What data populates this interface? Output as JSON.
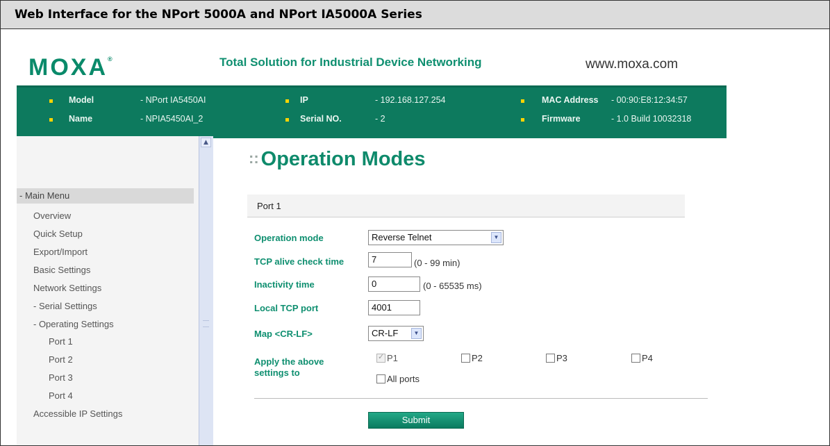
{
  "caption": "Web Interface for the NPort 5000A and NPort IA5000A Series",
  "header": {
    "logo": "MOXA",
    "logo_mark": "®",
    "tagline": "Total Solution for Industrial Device Networking",
    "website": "www.moxa.com"
  },
  "info": {
    "model_label": "Model",
    "model_value": "- NPort IA5450AI",
    "name_label": "Name",
    "name_value": "- NPIA5450AI_2",
    "ip_label": "IP",
    "ip_value": "- 192.168.127.254",
    "serial_label": "Serial NO.",
    "serial_value": "- 2",
    "mac_label": "MAC Address",
    "mac_value": "- 00:90:E8:12:34:57",
    "firmware_label": "Firmware",
    "firmware_value": "- 1.0 Build 10032318"
  },
  "sidebar": {
    "head": "- Main Menu",
    "items": [
      "Overview",
      "Quick Setup",
      "Export/Import",
      "Basic Settings",
      "Network Settings",
      "- Serial Settings",
      "- Operating Settings",
      "Port 1",
      "Port 2",
      "Port 3",
      "Port 4",
      "Accessible IP Settings"
    ]
  },
  "main": {
    "title": "Operation Modes",
    "title_dots": "::",
    "port_heading": "Port 1",
    "fields": {
      "operation_mode_label": "Operation mode",
      "operation_mode_value": "Reverse Telnet",
      "tcp_alive_label": "TCP alive check time",
      "tcp_alive_value": "7",
      "tcp_alive_hint": "(0 - 99 min)",
      "inactivity_label": "Inactivity time",
      "inactivity_value": "0",
      "inactivity_hint": "(0 - 65535 ms)",
      "local_tcp_label": "Local TCP port",
      "local_tcp_value": "4001",
      "map_label": "Map <CR-LF>",
      "map_value": "CR-LF",
      "apply_label_line1": "Apply the above",
      "apply_label_line2": "settings to"
    },
    "ports": [
      "P1",
      "P2",
      "P3",
      "P4"
    ],
    "all_ports_label": "All ports",
    "submit_label": "Submit"
  },
  "colors": {
    "brand_green": "#0d7a5e",
    "label_green": "#0f8f70",
    "bullet_yellow": "#ffd400"
  }
}
